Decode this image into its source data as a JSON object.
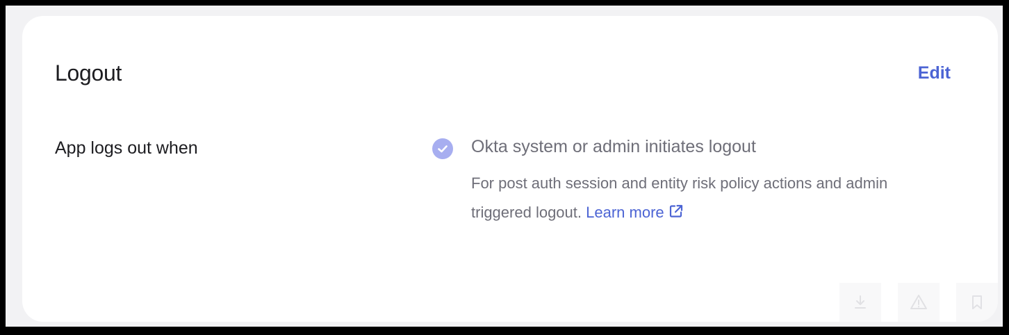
{
  "section": {
    "title": "Logout",
    "edit_label": "Edit"
  },
  "row": {
    "label": "App logs out when",
    "option": {
      "checked": true,
      "label": "Okta system or admin initiates logout",
      "description": "For post auth session and entity risk policy actions and admin triggered logout.",
      "learn_more": "Learn more"
    }
  },
  "icons": {
    "checkbox": "check-icon",
    "external_link": "external-link-icon",
    "corner_tools": [
      "download-icon",
      "warning-icon",
      "bookmark-icon"
    ]
  },
  "colors": {
    "accent": "#4c64d4",
    "checkbox": "#a7aef0",
    "text_primary": "#1d1d21",
    "text_secondary": "#6e6e78",
    "card": "#ffffff",
    "page": "#f2f2f4"
  }
}
